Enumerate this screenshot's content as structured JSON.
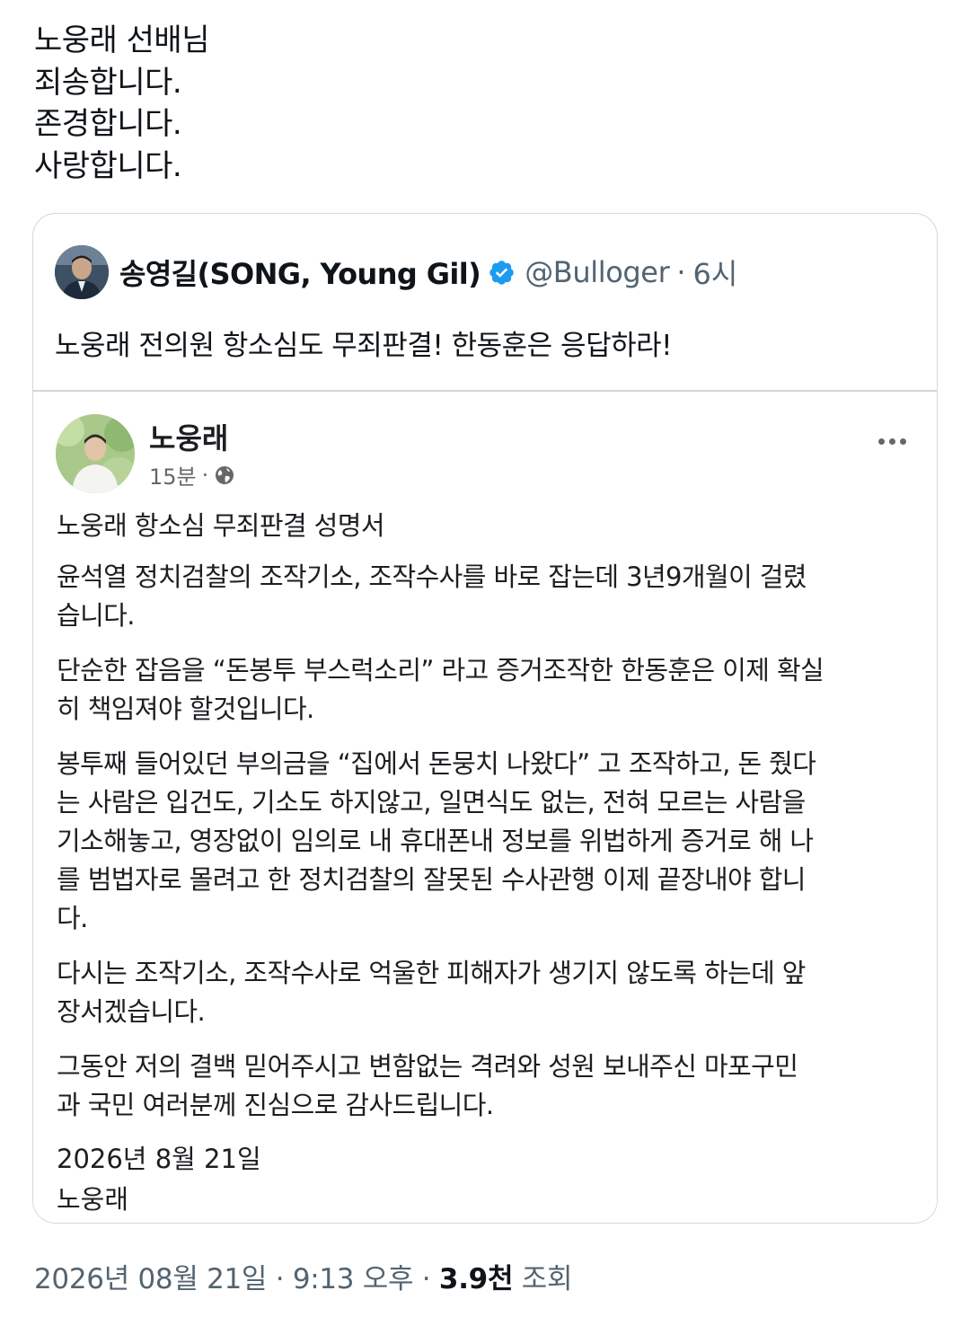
{
  "tweet": {
    "lines": [
      "노웅래 선배님",
      "죄송합니다.",
      "존경합니다.",
      "사랑합니다."
    ]
  },
  "quote": {
    "name": "송영길(SONG, Young Gil)",
    "handle": "@Bulloger",
    "dot": "·",
    "time": "6시",
    "text": "노웅래 전의원 항소심도 무죄판결! 한동훈은 응답하라!",
    "verified_color": "#1d9bf0"
  },
  "fb_post": {
    "author": "노웅래",
    "time": "15분",
    "dot": "·",
    "title": "노웅래 항소심 무죄판결 성명서",
    "paragraphs": [
      [
        "윤석열 정치검찰의 조작기소, 조작수사를 바로 잡는데 3년9개월이 걸렸",
        "습니다."
      ],
      [
        "단순한 잡음을 “돈봉투 부스럭소리” 라고 증거조작한 한동훈은 이제 확실",
        "히 책임져야 할것입니다."
      ],
      [
        "봉투째 들어있던 부의금을 “집에서 돈뭉치 나왔다” 고 조작하고, 돈 줬다",
        "는 사람은 입건도, 기소도 하지않고, 일면식도 없는, 전혀 모르는 사람을",
        "기소해놓고, 영장없이 임의로 내 휴대폰내 정보를 위법하게 증거로 해 나",
        "를 범법자로 몰려고 한 정치검찰의 잘못된 수사관행 이제 끝장내야 합니",
        "다."
      ],
      [
        "다시는 조작기소, 조작수사로 억울한 피해자가 생기지 않도록 하는데 앞",
        "장서겠습니다."
      ],
      [
        "그동안 저의 결백 믿어주시고 변함없는 격려와 성원 보내주신 마포구민",
        "과 국민 여러분께 진심으로 감사드립니다."
      ]
    ],
    "date": "2026년 8월 21일",
    "signature": "노웅래"
  },
  "footer": {
    "datetime": "2026년 08월 21일 · 9:13 오후",
    "bullet": "·",
    "views_count": "3.9천",
    "views_label": "조회"
  }
}
